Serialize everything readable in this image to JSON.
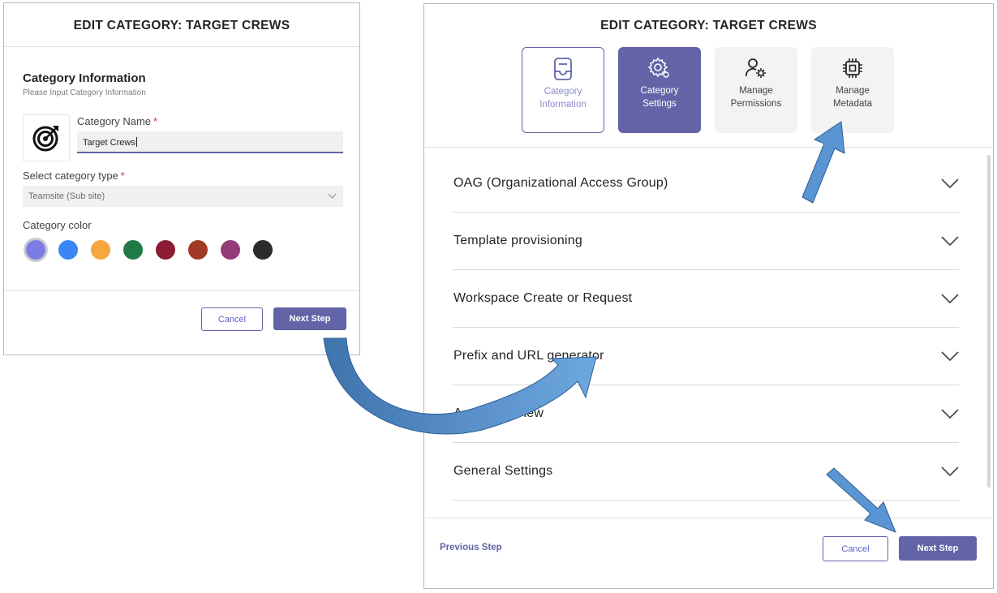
{
  "left_dialog": {
    "title": "EDIT CATEGORY: TARGET CREWS",
    "section_title": "Category Information",
    "section_subtitle": "Please Input Category Information",
    "icon": "target-icon",
    "name_label": "Category Name",
    "name_value": "Target Crews",
    "type_label": "Select category type",
    "type_value": "Teamsite (Sub site)",
    "color_label": "Category color",
    "required_mark": "*",
    "colors": [
      "#7b7de3",
      "#3a86f5",
      "#f7a640",
      "#1f7a45",
      "#8c1b33",
      "#a03a24",
      "#943a77",
      "#2b2b2b"
    ],
    "selected_color": "#7b7de3",
    "cancel_label": "Cancel",
    "next_label": "Next Step"
  },
  "right_dialog": {
    "title": "EDIT CATEGORY: TARGET CREWS",
    "steps": [
      {
        "label": "Category Information",
        "icon": "document-icon",
        "state": "done"
      },
      {
        "label": "Category Settings",
        "icon": "gear-cog-icon",
        "state": "active"
      },
      {
        "label": "Manage Permissions",
        "icon": "person-gear-icon",
        "state": "todo"
      },
      {
        "label": "Manage Metadata",
        "icon": "chip-icon",
        "state": "todo"
      }
    ],
    "sections": [
      "OAG (Organizational Access Group)",
      "Template provisioning",
      "Workspace Create or Request",
      "Prefix and URL generator",
      "Access Review",
      "General Settings"
    ],
    "previous_label": "Previous Step",
    "cancel_label": "Cancel",
    "next_label": "Next Step"
  },
  "colors": {
    "accent": "#6264a7",
    "arrow": "#4a86c8"
  }
}
